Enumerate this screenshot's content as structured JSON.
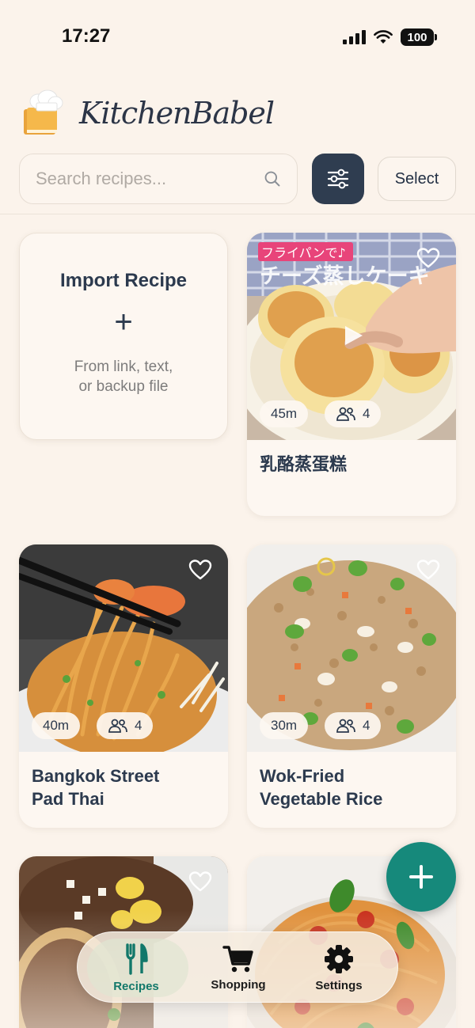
{
  "status_bar": {
    "time": "17:27",
    "battery": "100"
  },
  "app": {
    "name": "KitchenBabel"
  },
  "search": {
    "placeholder": "Search recipes..."
  },
  "toolbar": {
    "select_label": "Select"
  },
  "import_card": {
    "title": "Import Recipe",
    "plus": "+",
    "subtitle_line1": "From link, text,",
    "subtitle_line2": "or backup file"
  },
  "recipes": [
    {
      "title": "乳酪蒸蛋糕",
      "time": "45m",
      "servings": "4",
      "overlay_tag": "フライパンで♪",
      "overlay_caption": "チーズ蒸しケーキ"
    },
    {
      "title_line1": "Bangkok Street",
      "title_line2": "Pad Thai",
      "time": "40m",
      "servings": "4"
    },
    {
      "title_line1": "Wok-Fried",
      "title_line2": "Vegetable Rice",
      "time": "30m",
      "servings": "4"
    },
    {
      "title": "",
      "time": "",
      "servings": ""
    },
    {
      "title": "",
      "time": "",
      "servings": ""
    }
  ],
  "nav": {
    "items": [
      {
        "label": "Recipes",
        "icon": "fork-knife-icon",
        "active": true
      },
      {
        "label": "Shopping",
        "icon": "cart-icon",
        "active": false
      },
      {
        "label": "Settings",
        "icon": "gear-icon",
        "active": false
      }
    ]
  },
  "colors": {
    "accent": "#16897b",
    "filter_button": "#2f3d50",
    "background": "#fbf3eb"
  }
}
